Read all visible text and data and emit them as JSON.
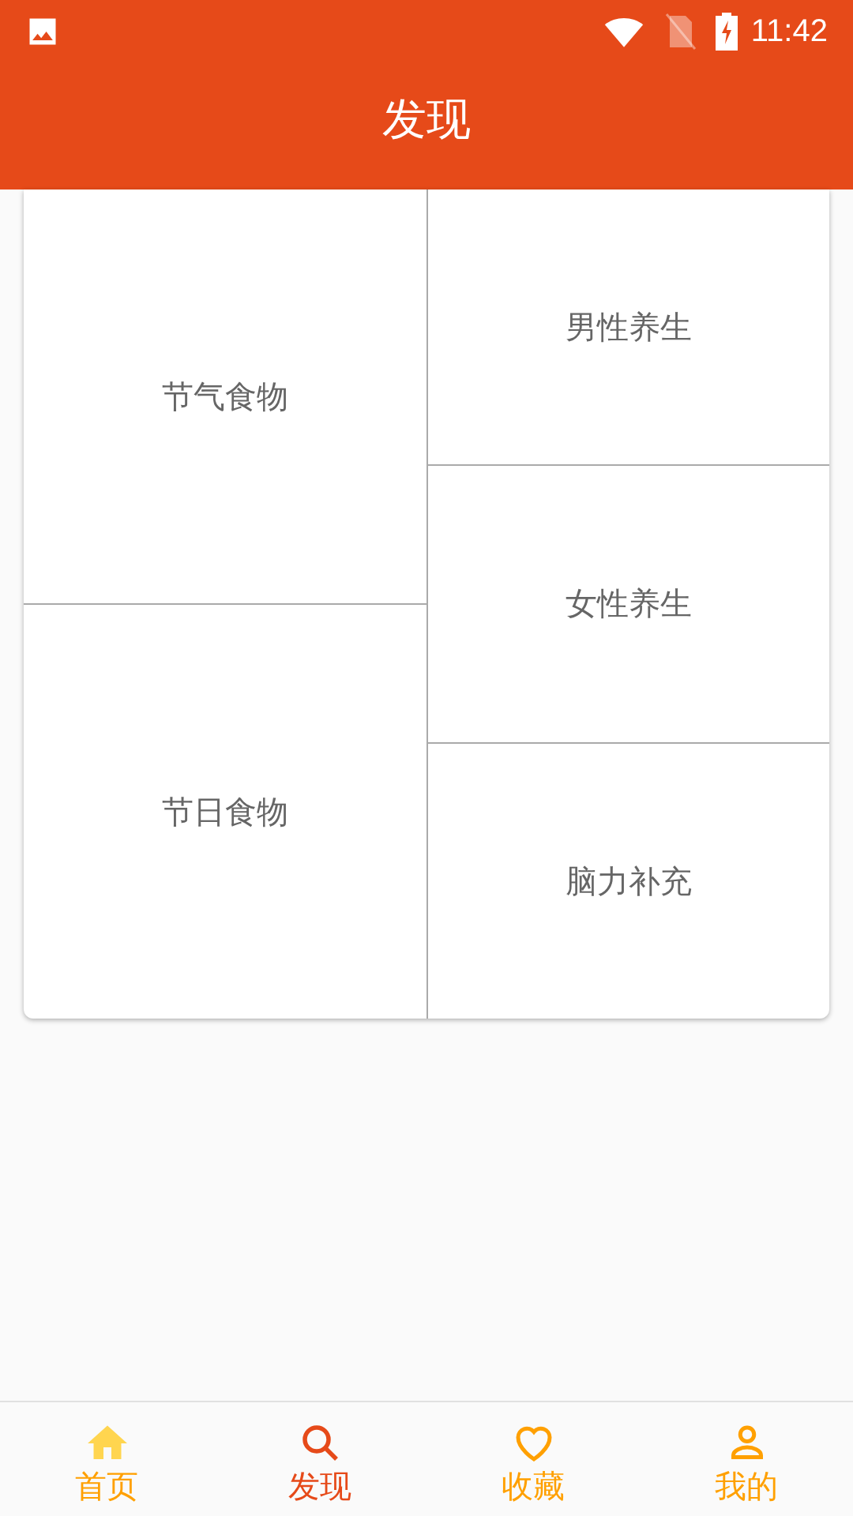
{
  "status_bar": {
    "time": "11:42"
  },
  "header": {
    "title": "发现"
  },
  "categories": {
    "columns": [
      {
        "items": [
          "节气食物",
          "节日食物"
        ]
      },
      {
        "items": [
          "男性养生",
          "女性养生",
          "脑力补充"
        ]
      }
    ]
  },
  "bottom_nav": [
    {
      "label": "首页",
      "selected": false
    },
    {
      "label": "发现",
      "selected": true
    },
    {
      "label": "收藏",
      "selected": false
    },
    {
      "label": "我的",
      "selected": false
    }
  ]
}
